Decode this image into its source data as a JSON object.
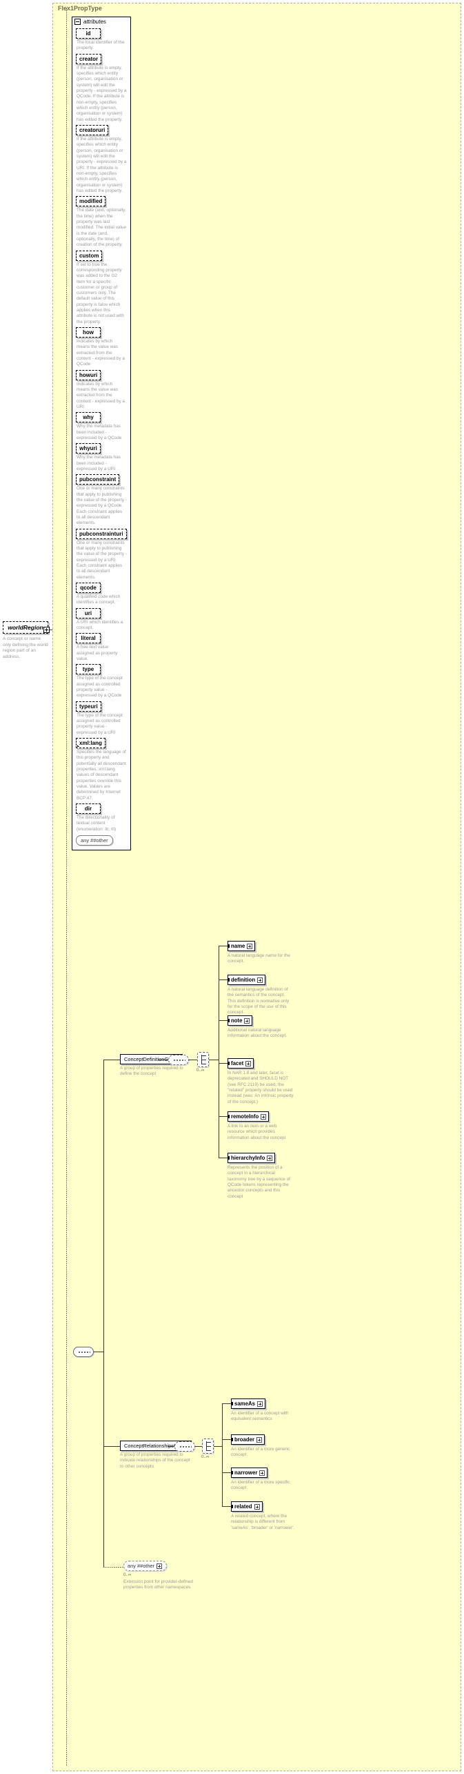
{
  "type_frame": {
    "title": "Flex1PropType"
  },
  "root_element": {
    "name": "worldRegion",
    "description": "A concept or name only defining the world region part of an address."
  },
  "attributes_panel": {
    "tab_label": "attributes",
    "items": [
      {
        "name": "id",
        "description": "The local identifier of the property."
      },
      {
        "name": "creator",
        "description": "If the attribute is empty, specifies which entity (person, organisation or system) will edit the property - expressed by a QCode. If the attribute is non-empty, specifies which entity (person, organisation or system) has edited the property."
      },
      {
        "name": "creatoruri",
        "description": "If the attribute is empty, specifies which entity (person, organisation or system) will edit the property - expressed by a URI. If the attribute is non-empty, specifies which entity (person, organisation or system) has edited the property."
      },
      {
        "name": "modified",
        "description": "The date (and, optionally, the time) when the property was last modified. The initial value is the date (and, optionally, the time) of creation of the property."
      },
      {
        "name": "custom",
        "description": "If set to true the corresponding property was added to the G2 Item for a specific customer or group of customers only. The default value of this property is false which applies when this attribute is not used with the property."
      },
      {
        "name": "how",
        "description": "Indicates by which means the value was extracted from the content - expressed by a QCode"
      },
      {
        "name": "howuri",
        "description": "Indicates by which means the value was extracted from the content - expressed by a URI"
      },
      {
        "name": "why",
        "description": "Why the metadata has been included - expressed by a QCode"
      },
      {
        "name": "whyuri",
        "description": "Why the metadata has been included - expressed by a URI"
      },
      {
        "name": "pubconstraint",
        "description": "One or many constraints that apply to publishing the value of the property - expressed by a QCode. Each constraint applies to all descendant elements."
      },
      {
        "name": "pubconstrainturi",
        "description": "One or many constraints that apply to publishing the value of the property - expressed by a URI. Each constraint applies to all descendant elements."
      },
      {
        "name": "qcode",
        "description": "A qualified code which identifies a concept."
      },
      {
        "name": "uri",
        "description": "A URI which identifies a concept."
      },
      {
        "name": "literal",
        "description": "A free-text value assigned as property value."
      },
      {
        "name": "type",
        "description": "The type of the concept assigned as controlled property value - expressed by a QCode"
      },
      {
        "name": "typeuri",
        "description": "The type of the concept assigned as controlled property value - expressed by a URI"
      },
      {
        "name": "xml:lang",
        "description": "Specifies the language of this property and potentially all descendant properties. xml:lang values of descendant properties override this value. Values are determined by Internet BCP 47."
      },
      {
        "name": "dir",
        "description": "The directionality of textual content (enumeration: ltr, rtl)"
      }
    ],
    "any_attribute": "any ##other"
  },
  "content_model": {
    "concept_definition_group": {
      "name": "ConceptDefinitionGroup",
      "description": "A group of properties required to define the concept",
      "cardinality": "0..∞",
      "elements": [
        {
          "name": "name",
          "description": "A natural language name for the concept."
        },
        {
          "name": "definition",
          "description": "A natural language definition of the semantics of the concept. This definition is normative only for the scope of the use of this concept."
        },
        {
          "name": "note",
          "description": "Additional natural language information about the concept."
        },
        {
          "name": "facet",
          "description": "In NAR 1.8 and later, facet is deprecated and SHOULD NOT (see RFC 2119) be used, the \"related\" property should be used instead (was: An intrinsic property of the concept.)"
        },
        {
          "name": "remoteInfo",
          "description": "A link to an item or a web resource which provides information about the concept"
        },
        {
          "name": "hierarchyInfo",
          "description": "Represents the position of a concept in a hierarchical taxonomy tree by a sequence of QCode tokens representing the ancestor concepts and this concept"
        }
      ]
    },
    "concept_relationships_group": {
      "name": "ConceptRelationshipsGroup",
      "description": "A group of properties required to indicate relationships of the concept to other concepts",
      "cardinality": "0..∞",
      "elements": [
        {
          "name": "sameAs",
          "description": "An identifier of a concept with equivalent semantics"
        },
        {
          "name": "broader",
          "description": "An identifier of a more generic concept."
        },
        {
          "name": "narrower",
          "description": "An identifier of a more specific concept."
        },
        {
          "name": "related",
          "description": "A related concept, where the relationship is different from 'sameAs', 'broader' or 'narrower'."
        }
      ]
    },
    "any_other": {
      "label": "any ##other",
      "cardinality": "0..∞",
      "description": "Extension point for provider-defined properties from other namespaces"
    }
  }
}
